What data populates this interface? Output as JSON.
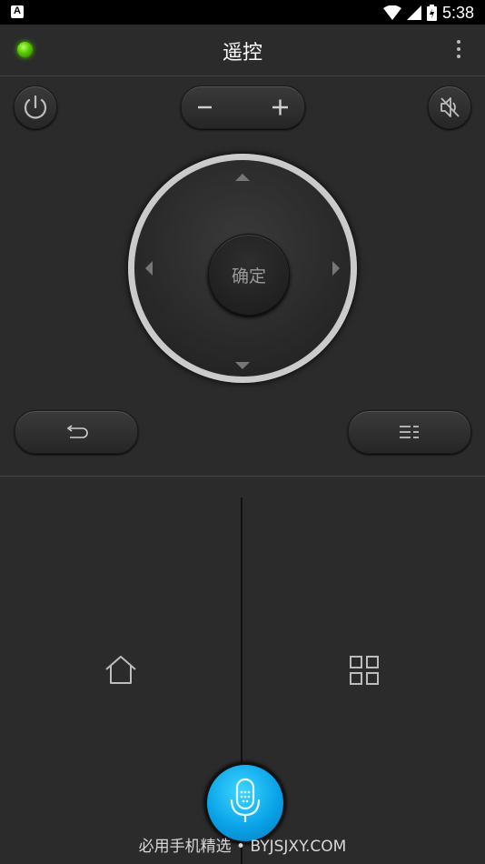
{
  "status_bar": {
    "time": "5:38"
  },
  "header": {
    "title": "遥控"
  },
  "dpad": {
    "ok_label": "确定"
  },
  "footer": {
    "watermark": "必用手机精选 • BYJSJXY.COM"
  },
  "colors": {
    "background": "#2b2b2b",
    "led": "#56c800",
    "mic_accent": "#0aa3e8"
  },
  "icons": {
    "power": "power-icon",
    "volume_down": "minus-icon",
    "volume_up": "plus-icon",
    "mute": "mute-icon",
    "back": "back-icon",
    "menu": "menu-icon",
    "home": "home-icon",
    "apps": "apps-grid-icon",
    "voice": "microphone-icon",
    "more": "more-vert-icon",
    "status": "connection-led-icon"
  }
}
